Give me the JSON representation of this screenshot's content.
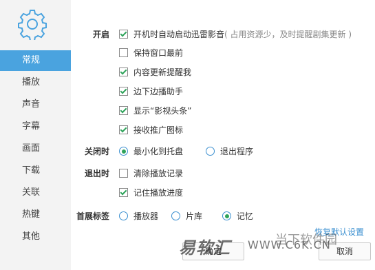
{
  "sidebar": {
    "items": [
      {
        "label": "常规",
        "active": true
      },
      {
        "label": "播放"
      },
      {
        "label": "声音"
      },
      {
        "label": "字幕"
      },
      {
        "label": "画面"
      },
      {
        "label": "下载"
      },
      {
        "label": "关联"
      },
      {
        "label": "热键"
      },
      {
        "label": "其他"
      }
    ],
    "active_color": "#4aa3df"
  },
  "startup": {
    "label": "开启",
    "options": [
      {
        "text": "开机时自动启动迅雷影音",
        "hint": "( 占用资源少，及时提醒剧集更新 )",
        "checked": true
      },
      {
        "text": "保持窗口最前",
        "checked": false
      },
      {
        "text": "内容更新提醒我",
        "checked": true
      },
      {
        "text": "边下边播助手",
        "checked": true
      },
      {
        "text": "显示“影视头条”",
        "checked": true
      },
      {
        "text": "接收推广图标",
        "checked": true
      }
    ]
  },
  "close": {
    "label": "关闭时",
    "options": [
      {
        "text": "最小化到托盘",
        "checked": true
      },
      {
        "text": "退出程序",
        "checked": false
      }
    ]
  },
  "exit": {
    "label": "退出时",
    "options": [
      {
        "text": "清除播放记录",
        "checked": false
      },
      {
        "text": "记住播放进度",
        "checked": true
      }
    ]
  },
  "home_tab": {
    "label": "首展标签",
    "options": [
      {
        "text": "播放器",
        "checked": false
      },
      {
        "text": "片库",
        "checked": false
      },
      {
        "text": "记忆",
        "checked": true
      }
    ]
  },
  "restore_link": "恢复默认设置",
  "buttons": {
    "ok": "确定",
    "cancel": "取消"
  },
  "watermark": {
    "brand": "易软汇",
    "url": "WWW.C6K.CN",
    "sub": "当下软件园"
  },
  "colors": {
    "check": "#2ea35a",
    "link": "#3a8fd0"
  }
}
